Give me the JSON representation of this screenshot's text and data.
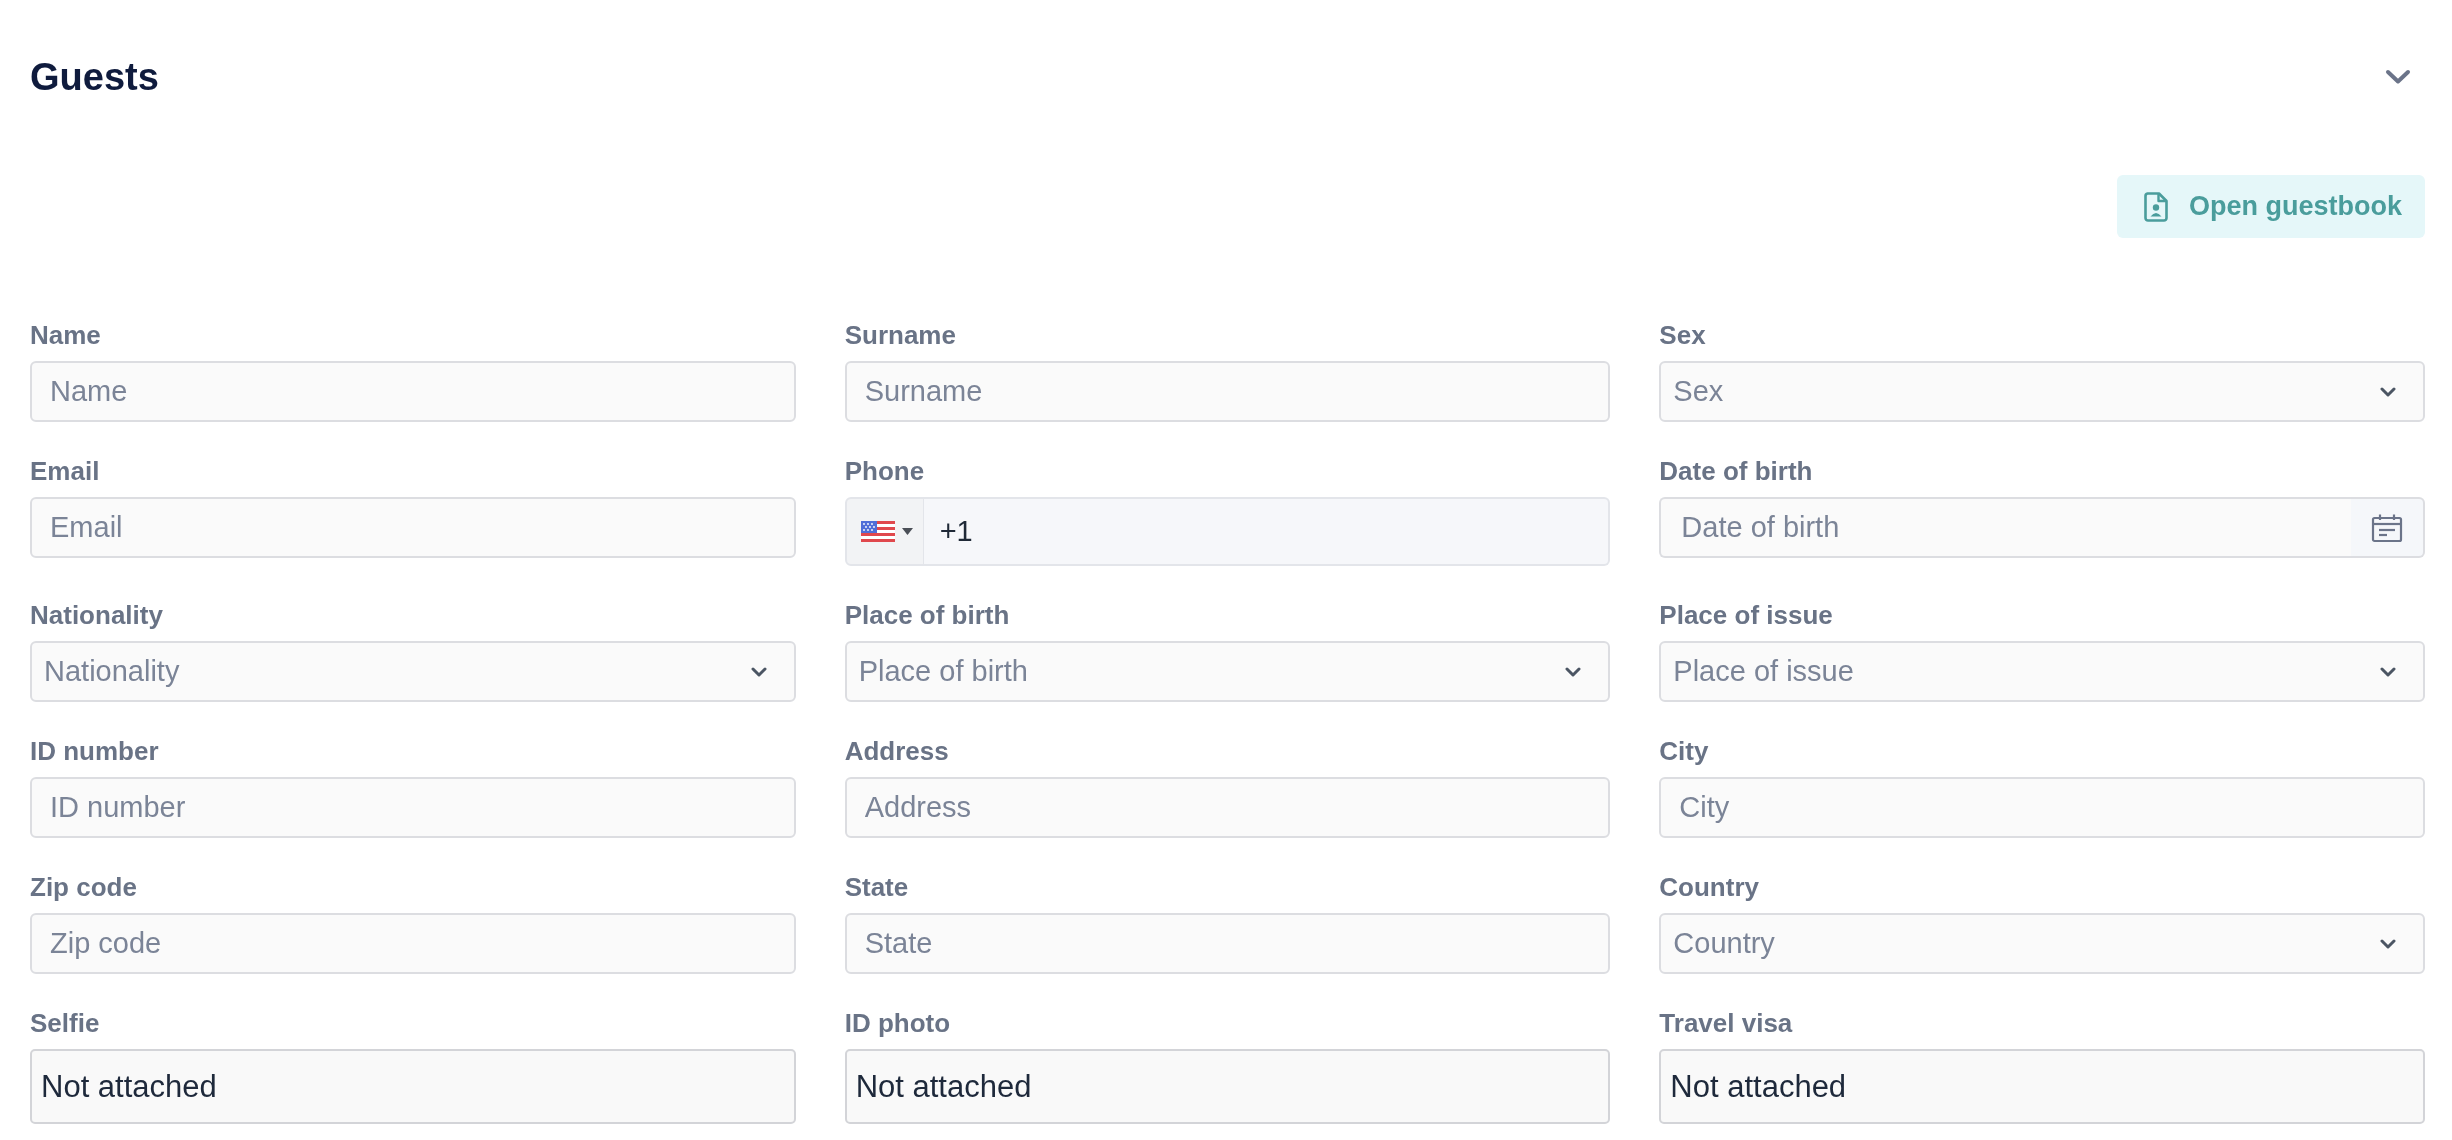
{
  "section": {
    "title": "Guests"
  },
  "guestbook_button": {
    "label": "Open guestbook"
  },
  "fields": [
    {
      "kind": "text",
      "label": "Name",
      "placeholder": "Name"
    },
    {
      "kind": "text",
      "label": "Surname",
      "placeholder": "Surname"
    },
    {
      "kind": "select",
      "label": "Sex",
      "placeholder": "Sex"
    },
    {
      "kind": "text",
      "label": "Email",
      "placeholder": "Email"
    },
    {
      "kind": "phone",
      "label": "Phone",
      "value": "+1"
    },
    {
      "kind": "date",
      "label": "Date of birth",
      "placeholder": "Date of birth"
    },
    {
      "kind": "select",
      "label": "Nationality",
      "placeholder": "Nationality"
    },
    {
      "kind": "select",
      "label": "Place of birth",
      "placeholder": "Place of birth"
    },
    {
      "kind": "select",
      "label": "Place of issue",
      "placeholder": "Place of issue"
    },
    {
      "kind": "text",
      "label": "ID number",
      "placeholder": "ID number"
    },
    {
      "kind": "text",
      "label": "Address",
      "placeholder": "Address"
    },
    {
      "kind": "text",
      "label": "City",
      "placeholder": "City"
    },
    {
      "kind": "text",
      "label": "Zip code",
      "placeholder": "Zip code"
    },
    {
      "kind": "text",
      "label": "State",
      "placeholder": "State"
    },
    {
      "kind": "select",
      "label": "Country",
      "placeholder": "Country"
    },
    {
      "kind": "attachment",
      "label": "Selfie",
      "value": "Not attached"
    },
    {
      "kind": "attachment",
      "label": "ID photo",
      "value": "Not attached"
    },
    {
      "kind": "attachment",
      "label": "Travel visa",
      "value": "Not attached"
    }
  ]
}
